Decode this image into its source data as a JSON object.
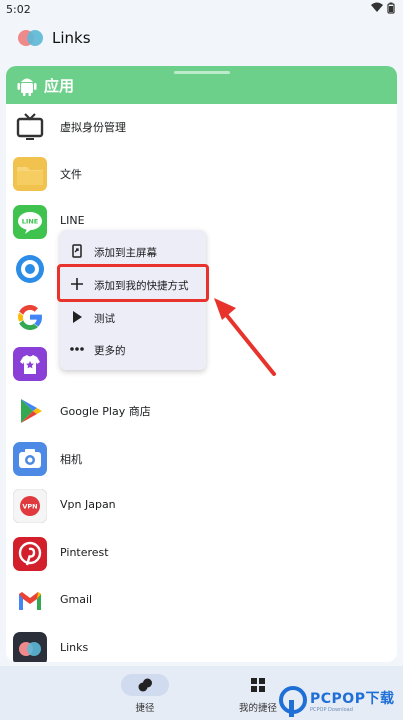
{
  "status_bar": {
    "time": "5:02"
  },
  "app_bar": {
    "title": "Links"
  },
  "section": {
    "title": "应用"
  },
  "apps": [
    {
      "name": "虚拟身份管理",
      "icon": "tv-icon"
    },
    {
      "name": "文件",
      "icon": "folder-icon"
    },
    {
      "name": "LINE",
      "icon": "line-icon",
      "badge": "LINE"
    },
    {
      "name": "",
      "icon": "blue-circle-app-icon"
    },
    {
      "name": "",
      "icon": "google-icon"
    },
    {
      "name": "",
      "icon": "purple-shirt-app-icon"
    },
    {
      "name": "Google Play 商店",
      "icon": "google-play-icon"
    },
    {
      "name": "相机",
      "icon": "camera-icon"
    },
    {
      "name": "Vpn Japan",
      "icon": "vpn-icon",
      "badge": "VPN"
    },
    {
      "name": "Pinterest",
      "icon": "pinterest-icon"
    },
    {
      "name": "Gmail",
      "icon": "gmail-icon"
    },
    {
      "name": "Links",
      "icon": "links-icon"
    }
  ],
  "context_menu": {
    "items": [
      {
        "label": "添加到主屏幕",
        "icon": "add-to-home-icon"
      },
      {
        "label": "添加到我的快捷方式",
        "icon": "plus-icon"
      },
      {
        "label": "测试",
        "icon": "play-icon"
      },
      {
        "label": "更多的",
        "icon": "more-icon"
      }
    ]
  },
  "bottom_nav": {
    "items": [
      {
        "label": "捷径",
        "icon": "shortcut-icon",
        "active": true
      },
      {
        "label": "我的捷径",
        "icon": "grid-icon",
        "active": false
      }
    ]
  },
  "watermark": {
    "text": "PCPOP下载",
    "small": "PCPOP Download"
  },
  "colors": {
    "header": "#6dd08a",
    "highlight": "#e8332c",
    "menu_bg": "#ecedf7",
    "nav_bg": "#e6ecf6",
    "watermark": "#1f6fd6"
  }
}
